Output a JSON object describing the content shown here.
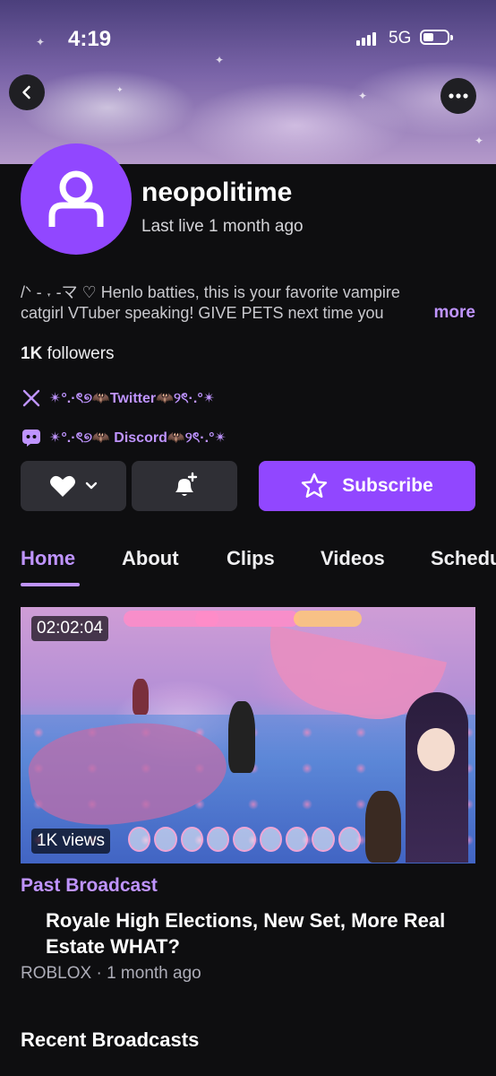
{
  "status_bar": {
    "time": "4:19",
    "network": "5G"
  },
  "channel": {
    "name": "neopolitime",
    "last_live": "Last live 1 month ago",
    "bio_line1": "/ᐠ - ˕ -マ ♡ Henlo batties, this is your favorite vampire",
    "bio_line2": "catgirl VTuber speaking! GIVE PETS next time you",
    "more_label": "more",
    "followers_count": "1K",
    "followers_label": "followers",
    "social": [
      {
        "icon": "x-icon",
        "label": "✴°.·ৎ୭🦇Twitter🦇୨ৎ·.°✴"
      },
      {
        "icon": "discord-icon",
        "label": "✴°.·ৎ୭🦇 Discord🦇୨ৎ·.°✴"
      }
    ]
  },
  "actions": {
    "subscribe_label": "Subscribe"
  },
  "tabs": [
    {
      "label": "Home",
      "active": true
    },
    {
      "label": "About",
      "active": false
    },
    {
      "label": "Clips",
      "active": false
    },
    {
      "label": "Videos",
      "active": false
    },
    {
      "label": "Schedule",
      "active": false
    }
  ],
  "featured_video": {
    "duration": "02:02:04",
    "views": "1K views",
    "type": "Past Broadcast",
    "title": "Royale High Elections, New Set, More Real Estate WHAT?",
    "meta": "ROBLOX · 1 month ago"
  },
  "sections": {
    "recent_broadcasts": "Recent Broadcasts"
  },
  "colors": {
    "accent": "#9147ff",
    "accent_text": "#bf94ff",
    "background": "#0e0e10",
    "button_dark": "#2f2f35"
  }
}
